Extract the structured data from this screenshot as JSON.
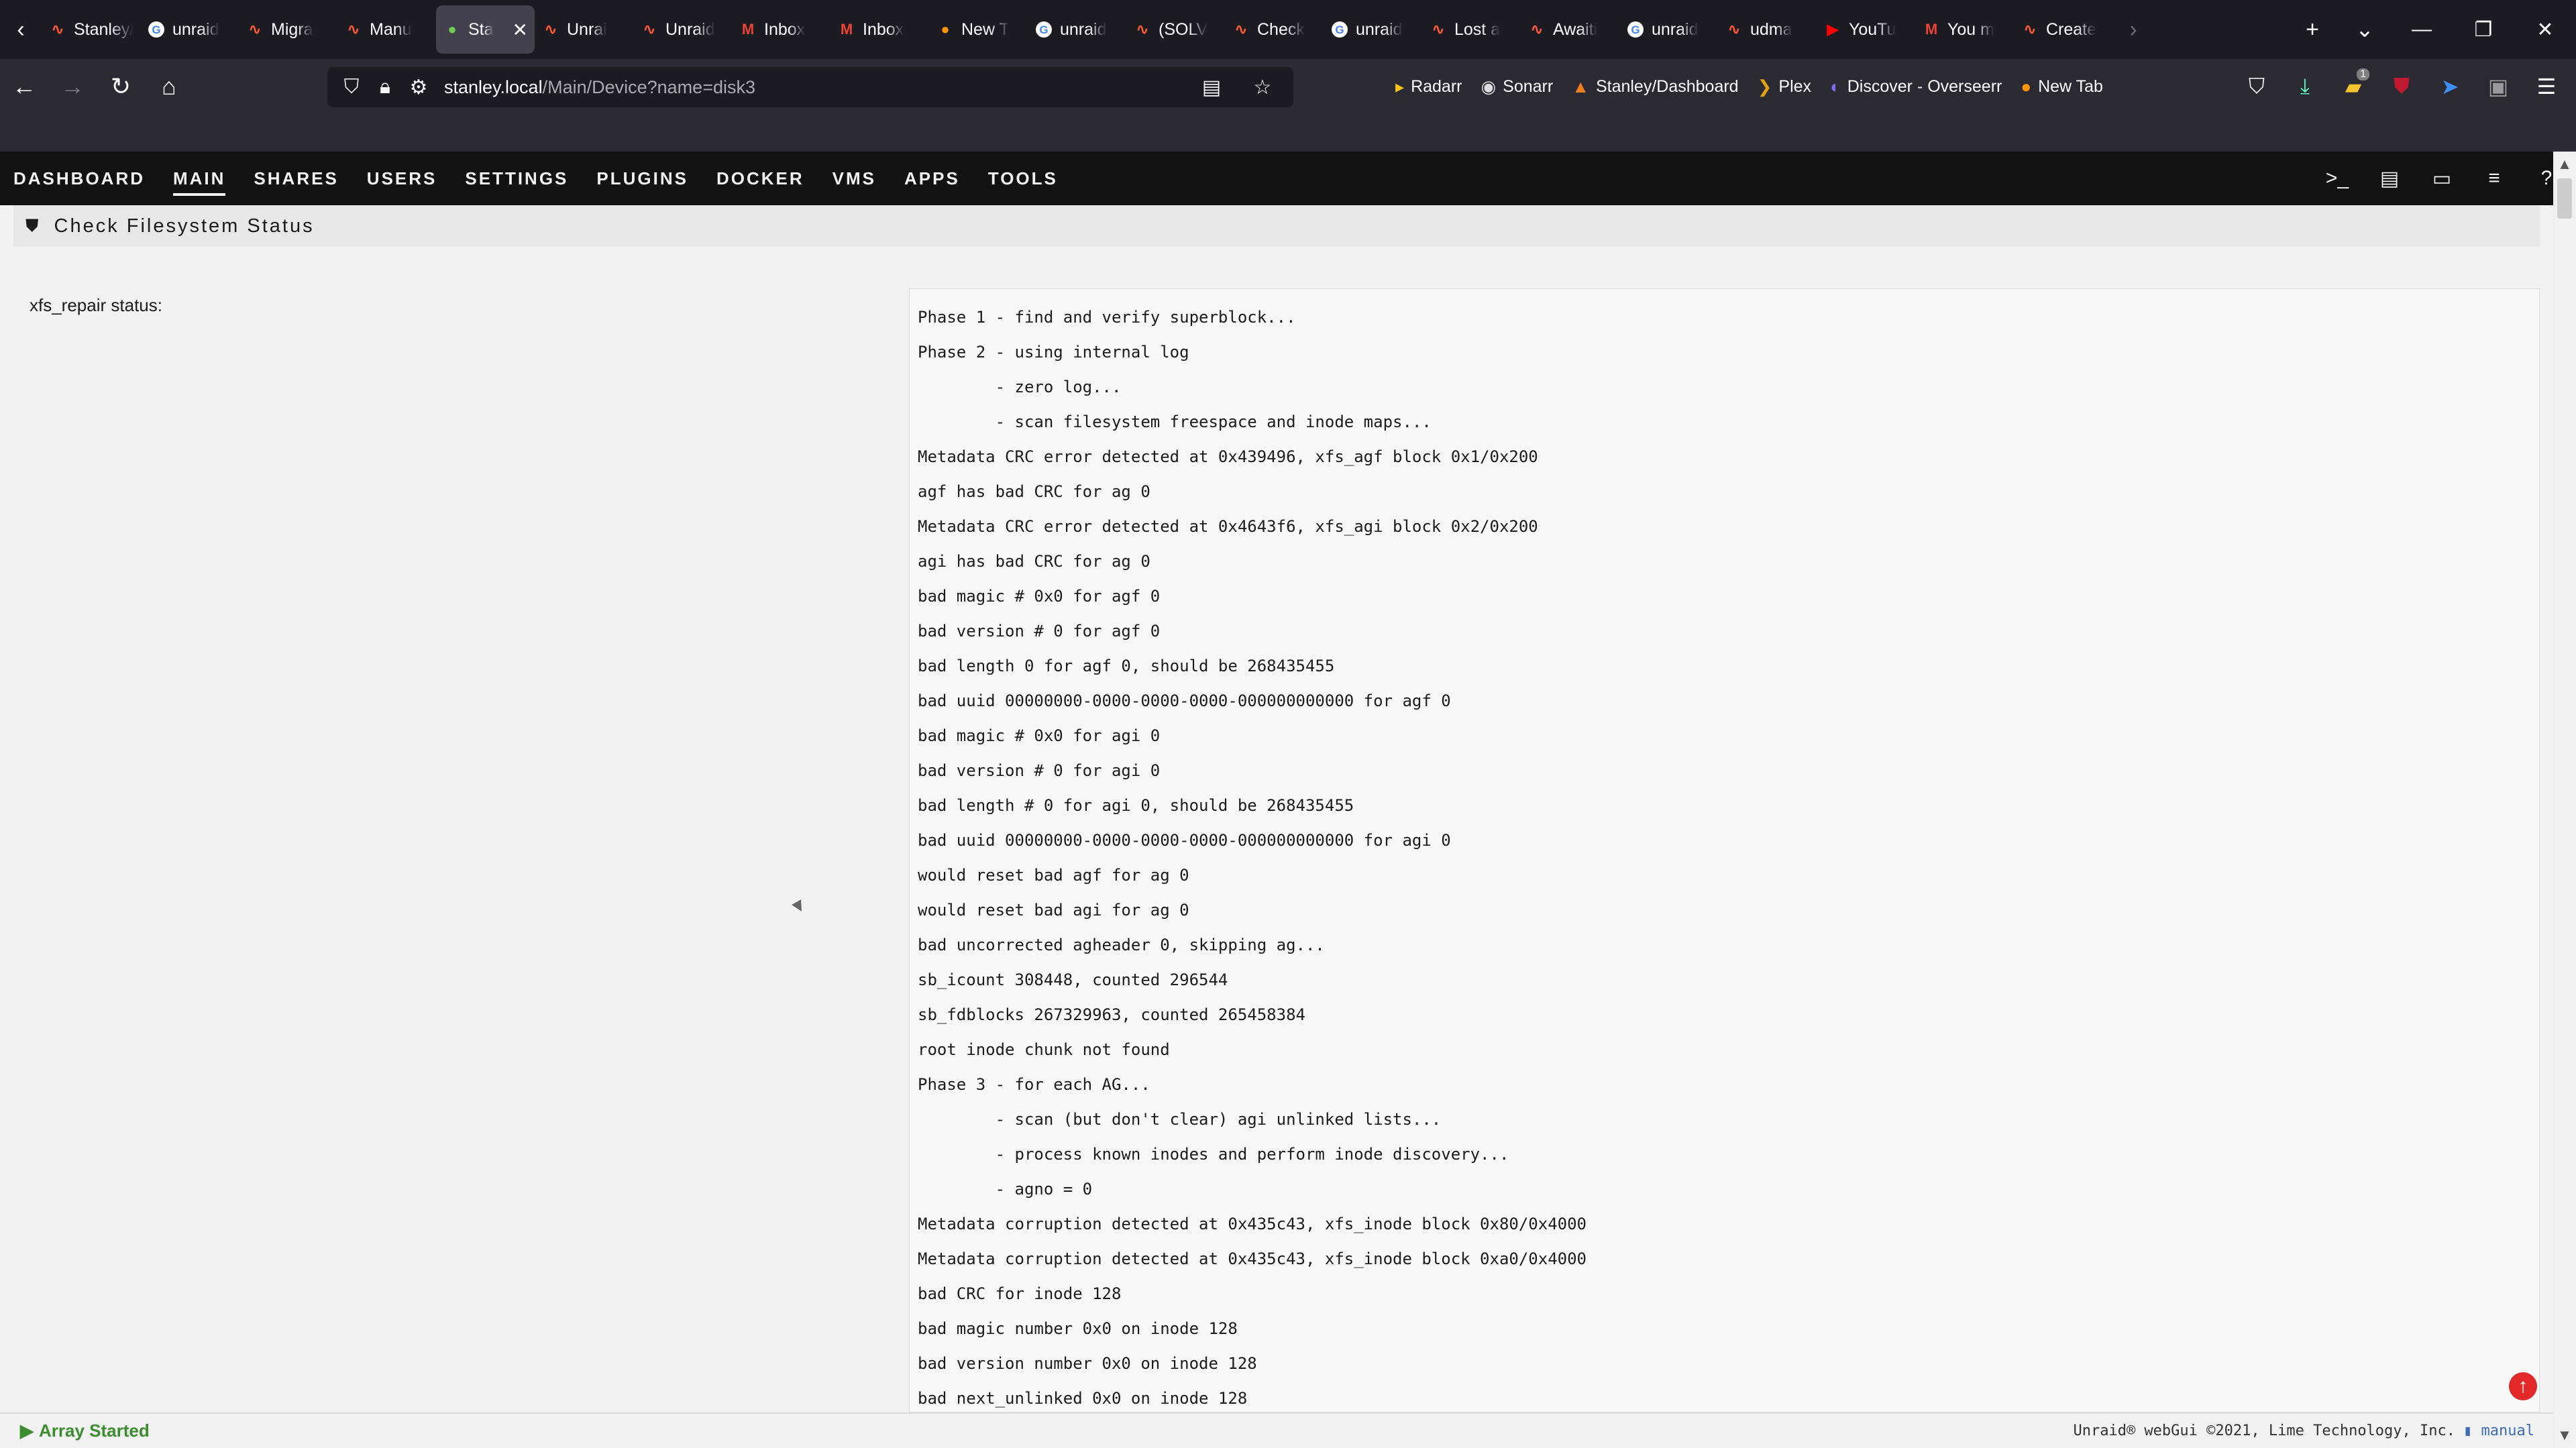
{
  "browser": {
    "tabs": [
      {
        "label": "Stanley/R",
        "icon": "unraid-icon"
      },
      {
        "label": "unraid",
        "icon": "google-icon"
      },
      {
        "label": "Migra",
        "icon": "unraid-icon"
      },
      {
        "label": "Manu",
        "icon": "unraid-icon"
      },
      {
        "label": "Sta",
        "icon": "dot-icon",
        "active": true
      },
      {
        "label": "Unrai",
        "icon": "unraid-icon"
      },
      {
        "label": "Unraid",
        "icon": "unraid-icon"
      },
      {
        "label": "Inbox",
        "icon": "gmail-icon"
      },
      {
        "label": "Inbox",
        "icon": "gmail-icon"
      },
      {
        "label": "New T",
        "icon": "firefox-icon"
      },
      {
        "label": "unraid",
        "icon": "google-icon"
      },
      {
        "label": "(SOLV",
        "icon": "unraid-icon"
      },
      {
        "label": "Check",
        "icon": "unraid-icon"
      },
      {
        "label": "unraid",
        "icon": "google-icon"
      },
      {
        "label": "Lost a",
        "icon": "unraid-icon"
      },
      {
        "label": "Awaiti",
        "icon": "unraid-icon"
      },
      {
        "label": "unraid",
        "icon": "google-icon"
      },
      {
        "label": "udma",
        "icon": "unraid-icon"
      },
      {
        "label": "YouTu",
        "icon": "youtube-icon"
      },
      {
        "label": "You m",
        "icon": "gmail-icon"
      },
      {
        "label": "Create",
        "icon": "unraid-icon"
      }
    ],
    "url_host": "stanley.local",
    "url_path": "/Main/Device?name=disk3",
    "bookmarks": [
      {
        "label": "Radarr",
        "icon": "radarr-icon"
      },
      {
        "label": "Sonarr",
        "icon": "sonarr-icon"
      },
      {
        "label": "Stanley/Dashboard",
        "icon": "unraid-icon"
      },
      {
        "label": "Plex",
        "icon": "plex-icon"
      },
      {
        "label": "Discover - Overseerr",
        "icon": "overseerr-icon"
      },
      {
        "label": "New Tab",
        "icon": "firefox-icon"
      }
    ],
    "download_badge": "1"
  },
  "unraid_nav": {
    "items": [
      "DASHBOARD",
      "MAIN",
      "SHARES",
      "USERS",
      "SETTINGS",
      "PLUGINS",
      "DOCKER",
      "VMS",
      "APPS",
      "TOOLS"
    ],
    "active": "MAIN"
  },
  "section": {
    "title": "Check Filesystem Status",
    "status_label": "xfs_repair status:"
  },
  "log_lines": [
    "Phase 1 - find and verify superblock...",
    "Phase 2 - using internal log",
    "        - zero log...",
    "        - scan filesystem freespace and inode maps...",
    "Metadata CRC error detected at 0x439496, xfs_agf block 0x1/0x200",
    "agf has bad CRC for ag 0",
    "Metadata CRC error detected at 0x4643f6, xfs_agi block 0x2/0x200",
    "agi has bad CRC for ag 0",
    "bad magic # 0x0 for agf 0",
    "bad version # 0 for agf 0",
    "bad length 0 for agf 0, should be 268435455",
    "bad uuid 00000000-0000-0000-0000-000000000000 for agf 0",
    "bad magic # 0x0 for agi 0",
    "bad version # 0 for agi 0",
    "bad length # 0 for agi 0, should be 268435455",
    "bad uuid 00000000-0000-0000-0000-000000000000 for agi 0",
    "would reset bad agf for ag 0",
    "would reset bad agi for ag 0",
    "bad uncorrected agheader 0, skipping ag...",
    "sb_icount 308448, counted 296544",
    "sb_fdblocks 267329963, counted 265458384",
    "root inode chunk not found",
    "Phase 3 - for each AG...",
    "        - scan (but don't clear) agi unlinked lists...",
    "        - process known inodes and perform inode discovery...",
    "        - agno = 0",
    "Metadata corruption detected at 0x435c43, xfs_inode block 0x80/0x4000",
    "Metadata corruption detected at 0x435c43, xfs_inode block 0xa0/0x4000",
    "bad CRC for inode 128",
    "bad magic number 0x0 on inode 128",
    "bad version number 0x0 on inode 128",
    "bad next_unlinked 0x0 on inode 128"
  ],
  "footer": {
    "array_status": "Array Started",
    "copyright": "Unraid® webGui ©2021, Lime Technology, Inc.",
    "manual_label": "manual"
  }
}
